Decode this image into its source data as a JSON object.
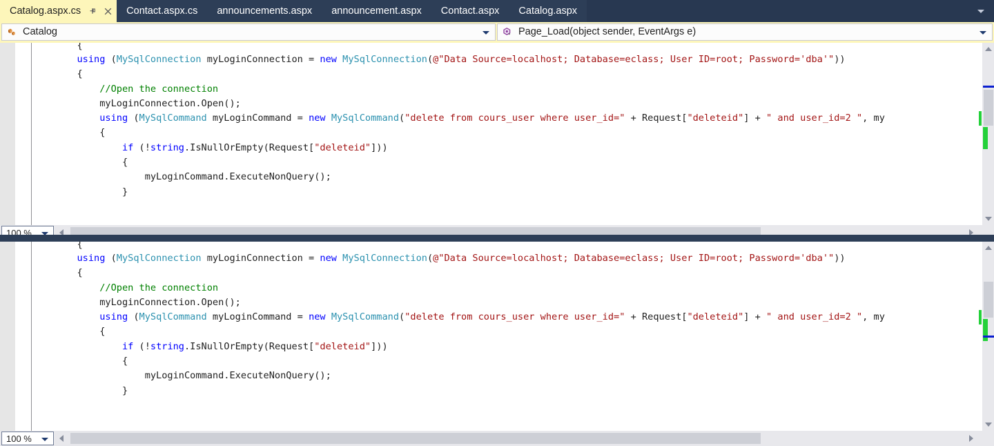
{
  "window": {
    "theme_background": "#2d3e57",
    "active_tab_background": "#fdf6ba",
    "accent_green": "#24d13a",
    "accent_blue": "#0b1fd0"
  },
  "tabs": [
    {
      "label": "Catalog.aspx.cs",
      "active": true,
      "pin_icon": "pin-icon",
      "close_icon": "close-icon"
    },
    {
      "label": "Contact.aspx.cs",
      "active": false
    },
    {
      "label": "announcements.aspx",
      "active": false
    },
    {
      "label": "announcement.aspx",
      "active": false
    },
    {
      "label": "Contact.aspx",
      "active": false
    },
    {
      "label": "Catalog.aspx",
      "active": false
    }
  ],
  "tab_overflow": {
    "icon": "chevron-down-icon"
  },
  "navbar": {
    "class_combo": {
      "icon": "class-icon",
      "value": "Catalog",
      "arrow_icon": "chevron-down-icon"
    },
    "member_combo": {
      "icon": "method-icon",
      "value": "Page_Load(object sender, EventArgs e)",
      "arrow_icon": "chevron-down-icon"
    }
  },
  "editor": {
    "zoom_level": "100 %",
    "zoom_arrow_icon": "chevron-down-icon",
    "hscroll": {
      "left_arrow_icon": "triangle-left-icon",
      "right_arrow_icon": "triangle-right-icon"
    },
    "vscroll": {
      "up_arrow_icon": "triangle-up-icon",
      "down_arrow_icon": "triangle-down-icon"
    },
    "partial_first_line": "        {",
    "lines": [
      {
        "indent": 8,
        "tokens": [
          {
            "c": "k",
            "t": "using"
          },
          {
            "c": "p",
            "t": " ("
          },
          {
            "c": "t",
            "t": "MySqlConnection"
          },
          {
            "c": "p",
            "t": " myLoginConnection = "
          },
          {
            "c": "k",
            "t": "new"
          },
          {
            "c": "p",
            "t": " "
          },
          {
            "c": "t",
            "t": "MySqlConnection"
          },
          {
            "c": "p",
            "t": "("
          },
          {
            "c": "s",
            "t": "@\"Data Source=localhost; Database=eclass; User ID=root; Password='dba'\""
          },
          {
            "c": "p",
            "t": "))"
          }
        ],
        "edited": false
      },
      {
        "indent": 8,
        "tokens": [
          {
            "c": "p",
            "t": "{"
          }
        ],
        "edited": false
      },
      {
        "indent": 12,
        "tokens": [
          {
            "c": "c",
            "t": "//Open the connection"
          }
        ],
        "edited": false
      },
      {
        "indent": 12,
        "tokens": [
          {
            "c": "p",
            "t": "myLoginConnection.Open();"
          }
        ],
        "edited": false
      },
      {
        "indent": 12,
        "tokens": [
          {
            "c": "k",
            "t": "using"
          },
          {
            "c": "p",
            "t": " ("
          },
          {
            "c": "t",
            "t": "MySqlCommand"
          },
          {
            "c": "p",
            "t": " myLoginCommand = "
          },
          {
            "c": "k",
            "t": "new"
          },
          {
            "c": "p",
            "t": " "
          },
          {
            "c": "t",
            "t": "MySqlCommand"
          },
          {
            "c": "p",
            "t": "("
          },
          {
            "c": "s",
            "t": "\"delete from cours_user where user_id=\""
          },
          {
            "c": "p",
            "t": " + Request["
          },
          {
            "c": "s",
            "t": "\"deleteid\""
          },
          {
            "c": "p",
            "t": "] + "
          },
          {
            "c": "s",
            "t": "\" and user_id=2 \""
          },
          {
            "c": "p",
            "t": ", my"
          }
        ],
        "edited": true
      },
      {
        "indent": 12,
        "tokens": [
          {
            "c": "p",
            "t": "{"
          }
        ],
        "edited": false
      },
      {
        "indent": 16,
        "tokens": [
          {
            "c": "k",
            "t": "if"
          },
          {
            "c": "p",
            "t": " (!"
          },
          {
            "c": "k",
            "t": "string"
          },
          {
            "c": "p",
            "t": ".IsNullOrEmpty(Request["
          },
          {
            "c": "s",
            "t": "\"deleteid\""
          },
          {
            "c": "p",
            "t": "]))"
          }
        ],
        "edited": false
      },
      {
        "indent": 16,
        "tokens": [
          {
            "c": "p",
            "t": "{"
          }
        ],
        "edited": false
      },
      {
        "indent": 20,
        "tokens": [
          {
            "c": "p",
            "t": "myLoginCommand.ExecuteNonQuery();"
          }
        ],
        "edited": false
      },
      {
        "indent": 16,
        "tokens": [
          {
            "c": "p",
            "t": "}"
          }
        ],
        "edited": false
      }
    ]
  }
}
